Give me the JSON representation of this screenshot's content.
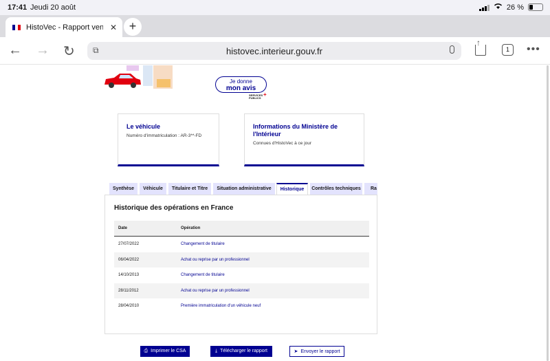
{
  "status_bar": {
    "time": "17:41",
    "date": "Jeudi 20 août",
    "battery": "26 %"
  },
  "browser": {
    "tab_title": "HistoVec - Rapport vendeur",
    "url": "histovec.interieur.gouv.fr",
    "tab_count": "1"
  },
  "feedback": {
    "line1": "Je donne",
    "line2": "mon avis",
    "services_l1": "SERVICES",
    "services_l2": "PUBLICS"
  },
  "cards": {
    "vehicle": {
      "title": "Le véhicule",
      "text": "Numéro d'immatriculation : AR-3**-FD"
    },
    "ministry": {
      "title": "Informations du Ministère de l'Intérieur",
      "text": "Connues d'HistoVec à ce jour"
    }
  },
  "tabs": [
    "Synthèse",
    "Véhicule",
    "Titulaire et Titre",
    "Situation administrative",
    "Historique",
    "Contrôles techniques",
    "Ra"
  ],
  "history": {
    "title": "Historique des opérations en France",
    "columns": [
      "Date",
      "Opération"
    ],
    "rows": [
      [
        "27/07/2022",
        "Changement de titulaire"
      ],
      [
        "06/04/2022",
        "Achat ou reprise par un professionnel"
      ],
      [
        "14/10/2013",
        "Changement de titulaire"
      ],
      [
        "28/11/2012",
        "Achat ou reprise par un professionnel"
      ],
      [
        "28/04/2010",
        "Première immatriculation d'un véhicule neuf"
      ]
    ]
  },
  "actions": {
    "print": "Imprimer le CSA",
    "download": "Télécharger le rapport",
    "send": "Envoyer le rapport"
  },
  "colors": {
    "primary": "#000091",
    "tab_bg": "#e3e3fd",
    "red": "#e1000f"
  }
}
